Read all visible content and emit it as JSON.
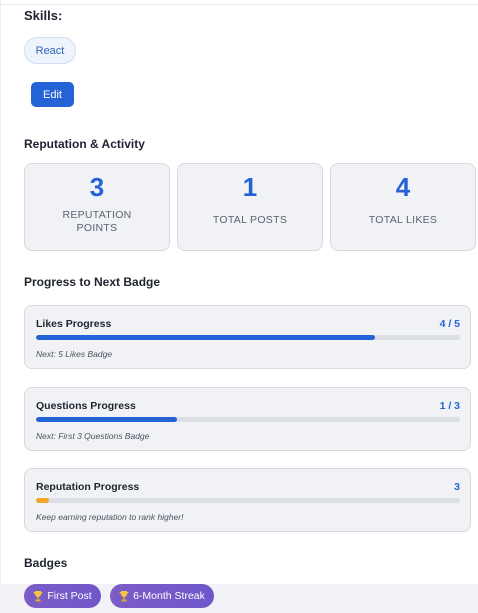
{
  "profile": {
    "skills_title": "Skills:",
    "skills": [
      "React"
    ],
    "edit_label": "Edit"
  },
  "reputation": {
    "title": "Reputation & Activity",
    "stats": [
      {
        "value": "3",
        "label": "REPUTATION POINTS"
      },
      {
        "value": "1",
        "label": "TOTAL POSTS"
      },
      {
        "value": "4",
        "label": "TOTAL LIKES"
      }
    ]
  },
  "progress": {
    "title": "Progress to Next Badge",
    "items": [
      {
        "title": "Likes Progress",
        "value": "4 / 5",
        "fraction": 0.8,
        "color": "#2463d6",
        "note": "Next: 5 Likes Badge"
      },
      {
        "title": "Questions Progress",
        "value": "1 / 3",
        "fraction": 0.333,
        "color": "#2463d6",
        "note": "Next: First 3 Questions Badge"
      },
      {
        "title": "Reputation Progress",
        "value": "3",
        "fraction": 0.03,
        "color": "#f2a623",
        "note": "Keep earning reputation to rank higher!"
      }
    ]
  },
  "badges": {
    "title": "Badges",
    "items": [
      {
        "label": "First Post",
        "icon": "trophy-icon"
      },
      {
        "label": "6-Month Streak",
        "icon": "trophy-icon"
      }
    ]
  },
  "colors": {
    "accent": "#2463d6",
    "badge": "#7c5cc6",
    "warning": "#f2a623"
  }
}
